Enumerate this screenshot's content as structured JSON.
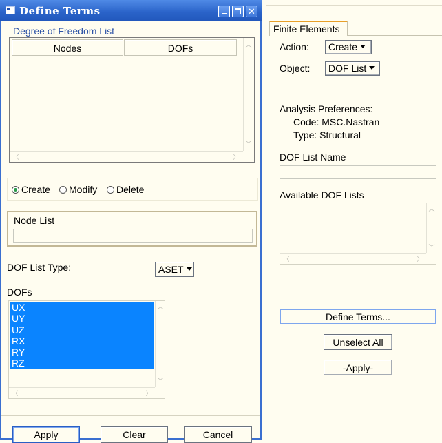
{
  "window": {
    "title": "Define Terms",
    "buttons": [
      "_",
      "□",
      "✕"
    ]
  },
  "dof_list_section": {
    "title": "Degree of Freedom List",
    "columns": [
      "Nodes",
      "DOFs"
    ]
  },
  "mode_radio": {
    "options": [
      "Create",
      "Modify",
      "Delete"
    ],
    "selected": "Create"
  },
  "node_list": {
    "label": "Node List",
    "value": ""
  },
  "dof_list_type": {
    "label": "DOF List Type:",
    "value": "ASET"
  },
  "dofs": {
    "label": "DOFs",
    "items": [
      "UX",
      "UY",
      "UZ",
      "RX",
      "RY",
      "RZ"
    ]
  },
  "bottom_buttons": {
    "apply": "Apply",
    "clear": "Clear",
    "cancel": "Cancel"
  },
  "right_panel": {
    "tab": "Finite Elements",
    "action_label": "Action:",
    "action_value": "Create",
    "object_label": "Object:",
    "object_value": "DOF List",
    "prefs_title": "Analysis Preferences:",
    "code_line": "Code: MSC.Nastran",
    "type_line": "Type: Structural",
    "dof_list_name_label": "DOF List Name",
    "dof_list_name_value": "",
    "available_label": "Available DOF Lists",
    "define_terms": "Define Terms...",
    "unselect_all": "Unselect All",
    "apply": "-Apply-"
  },
  "colors": {
    "title_bar": "#2f6fd6",
    "selection": "#0a84ff",
    "heading_blue": "#2d53a6",
    "background": "#fffdf0"
  }
}
